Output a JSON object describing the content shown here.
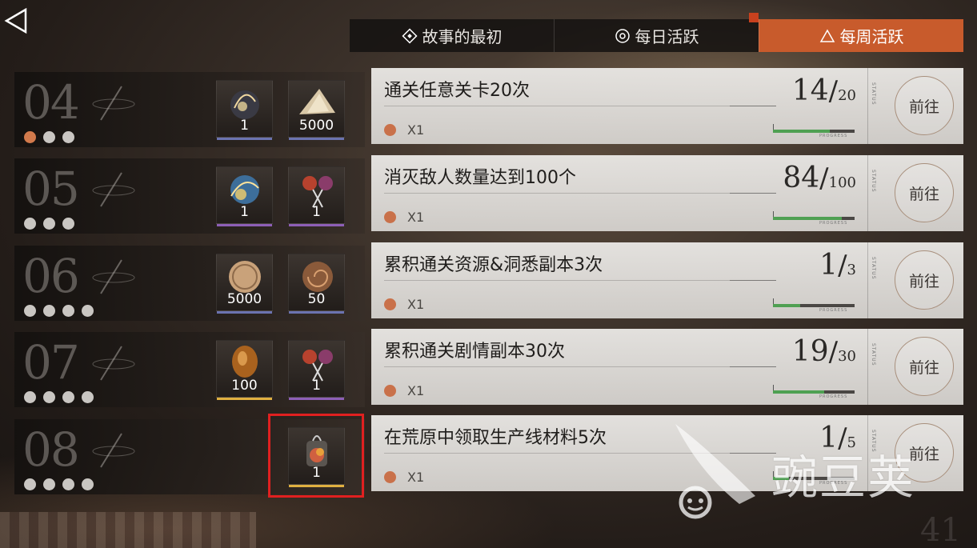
{
  "tabs": [
    {
      "label": "故事的最初",
      "icon": "diamond-icon",
      "marker": false
    },
    {
      "label": "每日活跃",
      "icon": "ring-icon",
      "marker": true
    },
    {
      "label": "每周活跃",
      "icon": "triangle-icon",
      "marker": true,
      "active": true
    }
  ],
  "rewards": [
    {
      "tier": "04",
      "dots_total": 3,
      "dots_on": 1,
      "items": [
        {
          "icon": "crystal-orb-icon",
          "qty": "1",
          "rarity_color": "#6b73b0"
        },
        {
          "icon": "crystal-shard-icon",
          "qty": "5000",
          "rarity_color": "#6b73b0"
        }
      ]
    },
    {
      "tier": "05",
      "dots_total": 3,
      "dots_on": 0,
      "items": [
        {
          "icon": "blue-orb-icon",
          "qty": "1",
          "rarity_color": "#8d5fb7"
        },
        {
          "icon": "lollipop-icon",
          "qty": "1",
          "rarity_color": "#8d5fb7"
        }
      ]
    },
    {
      "tier": "06",
      "dots_total": 4,
      "dots_on": 0,
      "items": [
        {
          "icon": "coin-icon",
          "qty": "5000",
          "rarity_color": "#6b73b0"
        },
        {
          "icon": "ammonite-icon",
          "qty": "50",
          "rarity_color": "#6b73b0"
        }
      ]
    },
    {
      "tier": "07",
      "dots_total": 4,
      "dots_on": 0,
      "items": [
        {
          "icon": "amber-orb-icon",
          "qty": "100",
          "rarity_color": "#e0b040"
        },
        {
          "icon": "lollipop-icon",
          "qty": "1",
          "rarity_color": "#8d5fb7"
        }
      ]
    },
    {
      "tier": "08",
      "dots_total": 4,
      "dots_on": 0,
      "items": [
        {
          "icon": "lantern-jar-icon",
          "qty": "1",
          "rarity_color": "#e0b040"
        }
      ]
    }
  ],
  "tasks": [
    {
      "title": "通关任意关卡20次",
      "reward": "X1",
      "current": "14",
      "total": "20",
      "progress": 0.7,
      "button": "前往"
    },
    {
      "title": "消灭敌人数量达到100个",
      "reward": "X1",
      "current": "84",
      "total": "100",
      "progress": 0.84,
      "button": "前往"
    },
    {
      "title": "累积通关资源&洞悉副本3次",
      "reward": "X1",
      "current": "1",
      "total": "3",
      "progress": 0.33,
      "button": "前往"
    },
    {
      "title": "累积通关剧情副本30次",
      "reward": "X1",
      "current": "19",
      "total": "30",
      "progress": 0.63,
      "button": "前往"
    },
    {
      "title": "在荒原中领取生产线材料5次",
      "reward": "X1",
      "current": "1",
      "total": "5",
      "progress": 0.2,
      "button": "前往"
    }
  ],
  "labels": {
    "status": "STATUS",
    "progress": "PROGRESS"
  },
  "watermark": "豌豆荚",
  "colors": {
    "accent": "#c85b2c",
    "progress_fill": "#4fa052",
    "highlight": "#e02020"
  }
}
